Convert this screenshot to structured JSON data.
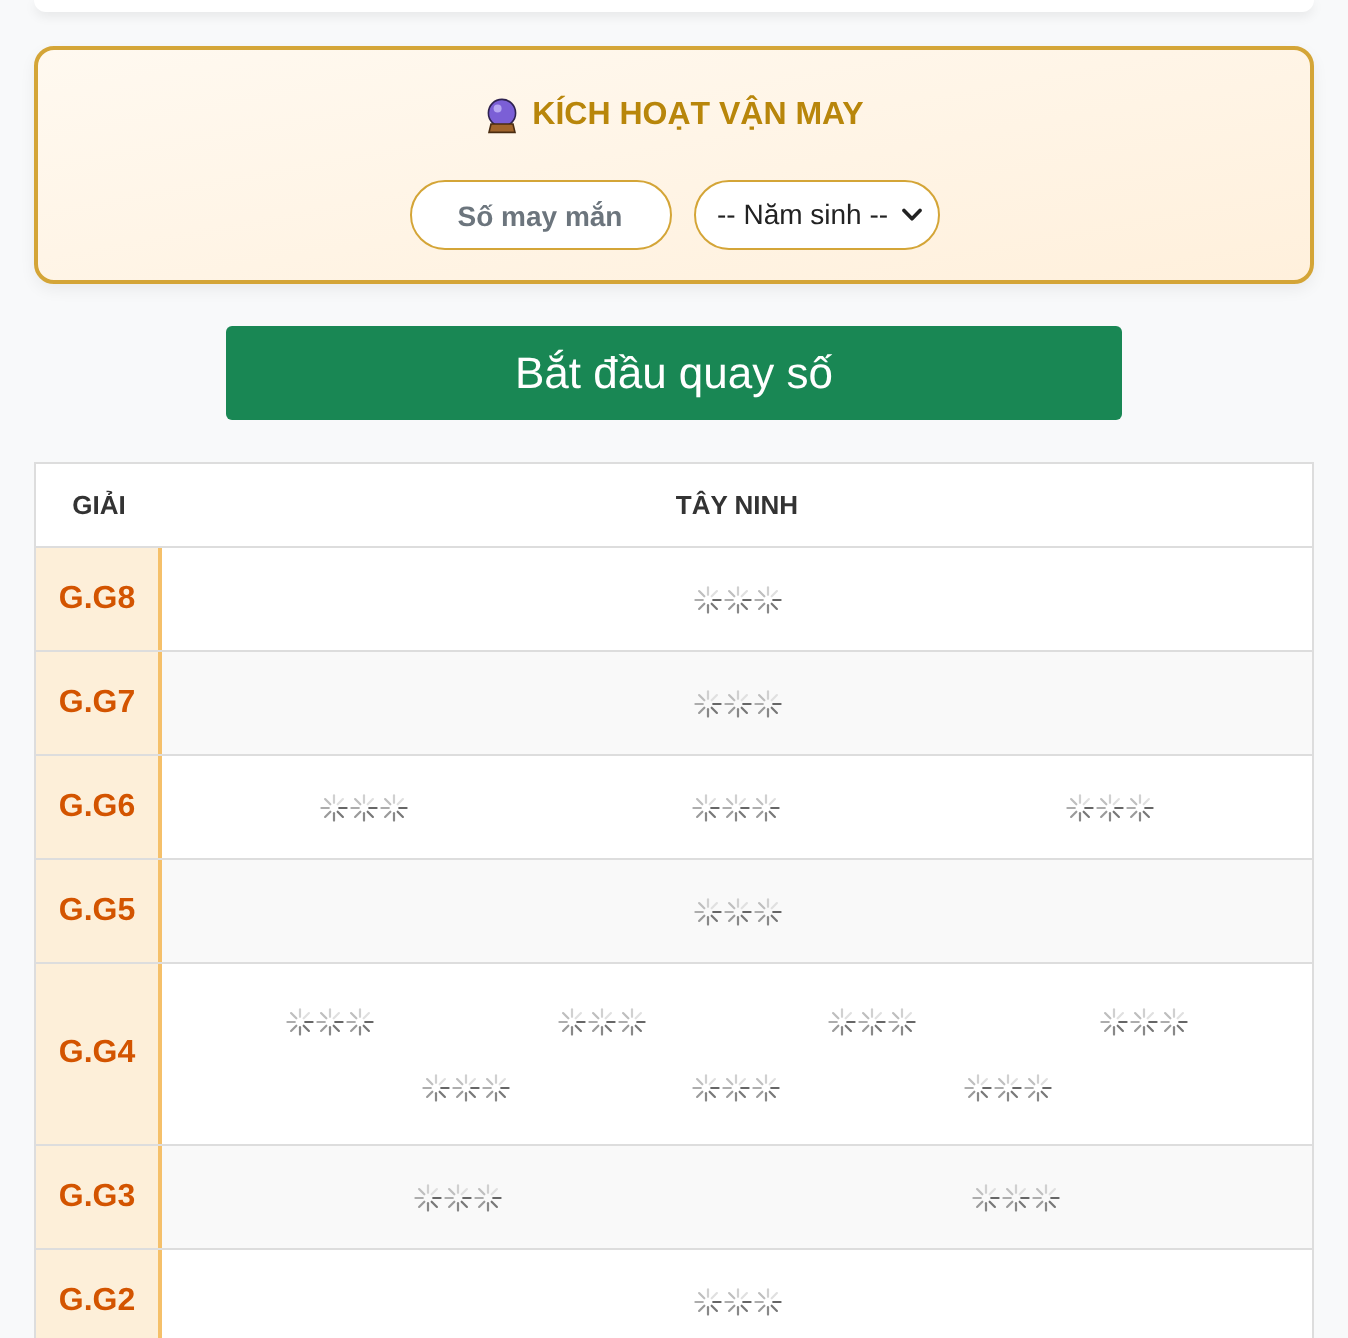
{
  "lucky_panel": {
    "title": "KÍCH HOẠT VẬN MAY",
    "lucky_number_field": {
      "placeholder": "Số may mắn"
    },
    "birth_year_select": {
      "value": "-- Năm sinh --"
    }
  },
  "start_button": {
    "label": "Bắt đầu quay số"
  },
  "results_table": {
    "columns": [
      "GIẢI",
      "TÂY NINH"
    ],
    "rows": [
      {
        "prize": "G.G8",
        "results": [
          {
            "loading": true
          }
        ]
      },
      {
        "prize": "G.G7",
        "results": [
          {
            "loading": true
          }
        ]
      },
      {
        "prize": "G.G6",
        "results": [
          {
            "loading": true
          },
          {
            "loading": true
          },
          {
            "loading": true
          }
        ]
      },
      {
        "prize": "G.G5",
        "results": [
          {
            "loading": true
          }
        ]
      },
      {
        "prize": "G.G4",
        "results": [
          {
            "loading": true
          },
          {
            "loading": true
          },
          {
            "loading": true
          },
          {
            "loading": true
          },
          {
            "loading": true
          },
          {
            "loading": true
          },
          {
            "loading": true
          }
        ]
      },
      {
        "prize": "G.G3",
        "results": [
          {
            "loading": true
          },
          {
            "loading": true
          }
        ]
      },
      {
        "prize": "G.G2",
        "results": [
          {
            "loading": true
          }
        ]
      }
    ]
  }
}
